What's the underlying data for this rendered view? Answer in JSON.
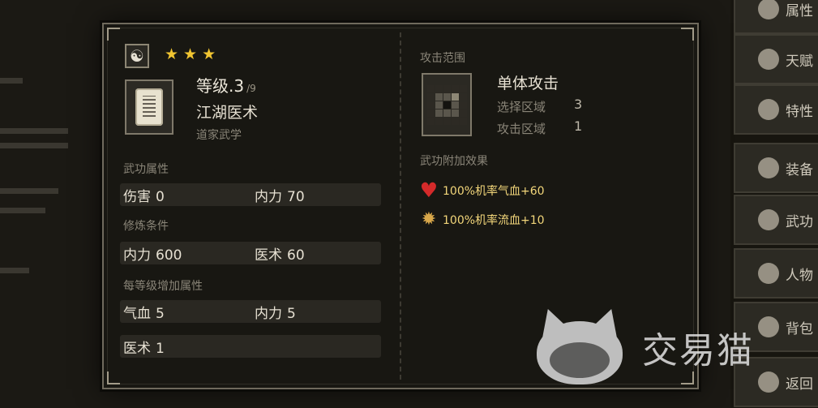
{
  "background": {
    "tabs": [
      {
        "label": "属性",
        "icon": "person-icon"
      },
      {
        "label": "天赋",
        "icon": "talent-icon"
      },
      {
        "label": "特性",
        "icon": "trait-icon"
      },
      {
        "label": "装备",
        "icon": "sword-icon"
      },
      {
        "label": "武功",
        "icon": "book-icon"
      },
      {
        "label": "人物",
        "icon": "people-icon"
      },
      {
        "label": "背包",
        "icon": "bag-icon"
      },
      {
        "label": "返回",
        "icon": "return-icon"
      }
    ]
  },
  "skill": {
    "school_icon": "yin-yang-icon",
    "stars": 3,
    "level_label": "等级.3",
    "level_max": "/9",
    "name": "江湖医术",
    "school": "道家武学",
    "attributes_title": "武功属性",
    "attributes": [
      {
        "label": "伤害",
        "value": "0"
      },
      {
        "label": "内力",
        "value": "70"
      }
    ],
    "requirements_title": "修炼条件",
    "requirements": [
      {
        "label": "内力",
        "value": "600"
      },
      {
        "label": "医术",
        "value": "60"
      }
    ],
    "per_level_title": "每等级增加属性",
    "per_level": [
      {
        "label": "气血",
        "value": "5"
      },
      {
        "label": "内力",
        "value": "5"
      },
      {
        "label": "医术",
        "value": "1"
      }
    ]
  },
  "attack": {
    "range_title": "攻击范围",
    "type": "单体攻击",
    "select_label": "选择区域",
    "select_value": "3",
    "attack_label": "攻击区域",
    "attack_value": "1",
    "effects_title": "武功附加效果",
    "effects": [
      {
        "icon": "heart-icon",
        "text": "100%机率气血+60",
        "color": "#d42a2a"
      },
      {
        "icon": "blood-splat-icon",
        "text": "100%机率流血+10",
        "color": "#d9a84a"
      }
    ]
  },
  "watermark": {
    "text": "交易猫"
  }
}
